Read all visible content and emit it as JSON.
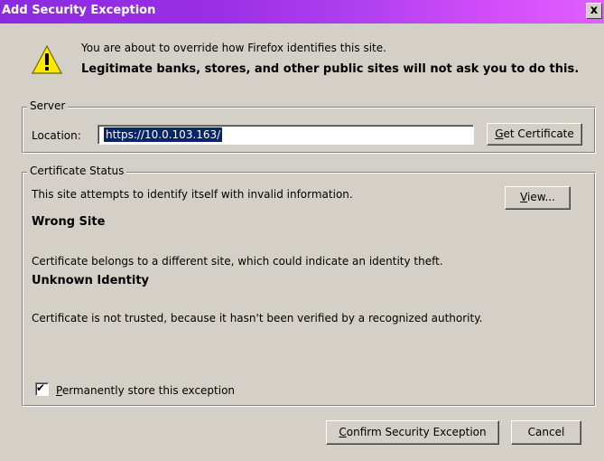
{
  "dialog": {
    "title": "Add Security Exception",
    "close_glyph": "x"
  },
  "message": {
    "line1": "You are about to override how Firefox identifies this site.",
    "line2": "Legitimate banks, stores, and other public sites will not ask you to do this."
  },
  "server": {
    "legend": "Server",
    "location_label": "Location:",
    "location_value": "https://10.0.103.163/",
    "get_cert_label_underlined": "G",
    "get_cert_label_rest": "et Certificate"
  },
  "status": {
    "legend": "Certificate Status",
    "intro": "This site attempts to identify itself with invalid information.",
    "view_underlined": "V",
    "view_rest": "iew...",
    "wrong_site_heading": "Wrong Site",
    "wrong_site_text": "Certificate belongs to a different site, which could indicate an identity theft.",
    "unknown_heading": "Unknown Identity",
    "unknown_text": "Certificate is not trusted, because it hasn't been verified by a recognized authority."
  },
  "options": {
    "permanent_checked": true,
    "permanent_underlined": "P",
    "permanent_rest": "ermanently store this exception"
  },
  "buttons": {
    "confirm_underlined": "C",
    "confirm_rest": "onfirm Security Exception",
    "cancel": "Cancel"
  }
}
